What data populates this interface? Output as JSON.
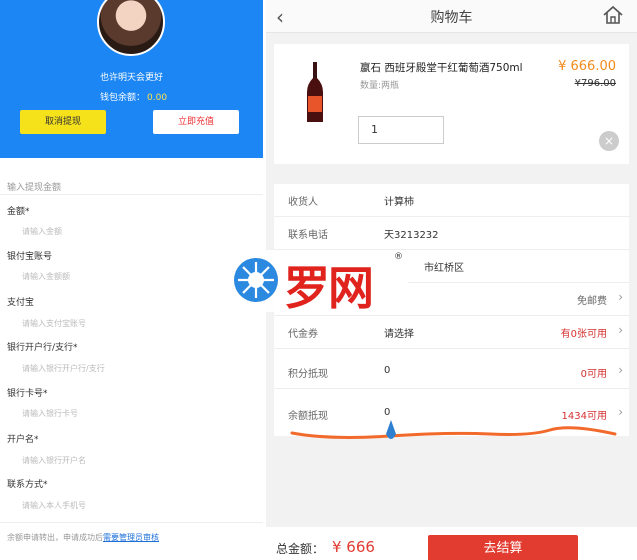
{
  "left": {
    "motto": "也许明天会更好",
    "balance_label": "钱包余额：",
    "balance_value": "0.00",
    "cancel_button": "取消提现",
    "recharge_button": "立即充值",
    "section_hint": "输入提现金额",
    "fields": [
      {
        "label": "金额*",
        "placeholder": "请输入金额"
      },
      {
        "label": "银付宝账号",
        "placeholder": "请输入金额额"
      },
      {
        "label": "支付宝",
        "placeholder": "请输入支付宝账号"
      },
      {
        "label": "银行开户行/支行*",
        "placeholder": "请输入银行开户行/支行"
      },
      {
        "label": "银行卡号*",
        "placeholder": "请输入银行卡号"
      },
      {
        "label": "开户名*",
        "placeholder": "请输入银行开户名"
      },
      {
        "label": "联系方式*",
        "placeholder": "请输入本人手机号"
      }
    ],
    "footer_text": "余额申请转出，申请成功后",
    "footer_link": "需要管理员审核"
  },
  "right": {
    "title": "购物车",
    "product": {
      "name": "嬴石 西班牙殿堂干红葡萄酒750ml",
      "qty_label": "数量:两瓶",
      "price": "¥ 666.00",
      "old_price": "¥796.00",
      "quantity": "1"
    },
    "rows": [
      {
        "label": "收货人",
        "value": "计算柿",
        "right": "",
        "chev": false
      },
      {
        "label": "联系电话",
        "value": "天3213232",
        "right": "",
        "chev": false
      },
      {
        "label": "",
        "value": "市红桥区",
        "right": "",
        "chev": false
      },
      {
        "label": "",
        "value": "",
        "right": "免邮费",
        "chev": true
      },
      {
        "label": "代金券",
        "value": "请选择",
        "right": "有0张可用",
        "chev": true,
        "red": true
      },
      {
        "label": "积分抵现",
        "value": "0",
        "right": "0可用",
        "chev": true,
        "red": true
      },
      {
        "label": "余额抵现",
        "value": "0",
        "right": "1434可用",
        "chev": true,
        "red": true
      }
    ],
    "total_label": "总金额：",
    "total_value": "¥ 666",
    "checkout": "去结算"
  },
  "watermark": {
    "text": "罗网",
    "reg": "®"
  },
  "colors": {
    "blue": "#1b86f4",
    "red": "#e23b2f",
    "orange": "#f18a1b"
  }
}
